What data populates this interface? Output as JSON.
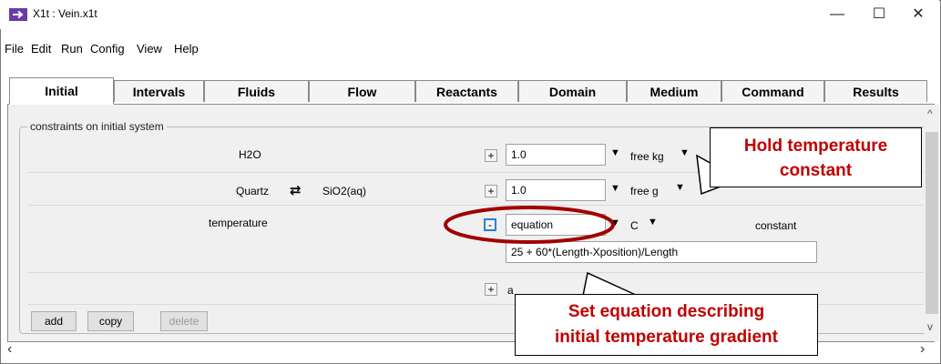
{
  "window": {
    "title": "X1t : Vein.x1t",
    "minimize": "—",
    "maximize": "☐",
    "close": "✕"
  },
  "menu": [
    "File",
    "Edit",
    "Run",
    "Config",
    "View",
    "Help"
  ],
  "tabs": [
    "Initial",
    "Intervals",
    "Fluids",
    "Flow",
    "Reactants",
    "Domain",
    "Medium",
    "Command",
    "Results"
  ],
  "active_tab": "Initial",
  "group_label": "constraints on initial system",
  "rows": {
    "h2o": {
      "name": "H2O",
      "button": "+",
      "value": "1.0",
      "unit": "free kg"
    },
    "quartz": {
      "name": "Quartz",
      "swap": "⇄",
      "alt": "SiO2(aq)",
      "button": "+",
      "value": "1.0",
      "unit": "free g"
    },
    "temperature": {
      "name": "temperature",
      "button": "-",
      "value": "equation",
      "unit": "C",
      "mode": "constant",
      "equation": "25 + 60*(Length-Xposition)/Length"
    },
    "add_row": {
      "button": "+",
      "partial": "a"
    }
  },
  "buttons": {
    "add": "add",
    "copy": "copy",
    "delete": "delete"
  },
  "callouts": {
    "hold": [
      "Hold temperature",
      "constant"
    ],
    "equation": [
      "Set equation describing",
      "initial temperature gradient"
    ]
  },
  "scroll": {
    "left": "‹",
    "right": "›",
    "up": "^",
    "down": "v"
  },
  "colors": {
    "callout_text": "#c00000",
    "ellipse": "#a00000",
    "focus": "#2d7fd9"
  }
}
